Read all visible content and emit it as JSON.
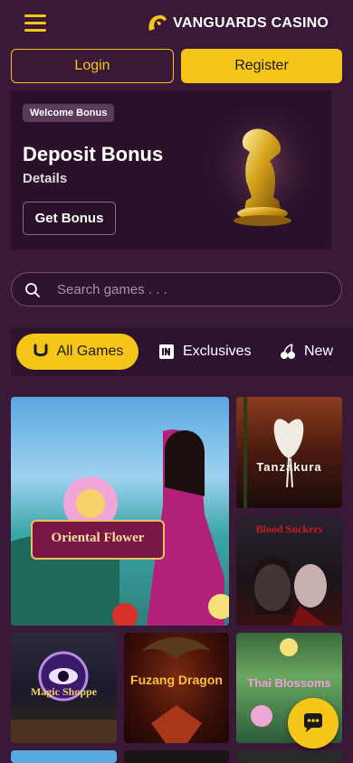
{
  "header": {
    "logo_brand": "VANGUARDS",
    "logo_suffix": "CASINO"
  },
  "auth": {
    "login_label": "Login",
    "register_label": "Register"
  },
  "banner": {
    "badge": "Welcome Bonus",
    "title": "Deposit Bonus",
    "subtitle": "Details",
    "button_label": "Get Bonus"
  },
  "search": {
    "placeholder": "Search games . . ."
  },
  "tabs": [
    {
      "label": "All Games",
      "icon": "horseshoe-icon",
      "active": true
    },
    {
      "label": "Exclusives",
      "icon": "exclusive-icon",
      "active": false
    },
    {
      "label": "New",
      "icon": "cherries-icon",
      "active": false
    }
  ],
  "games": [
    {
      "title": "Oriental Flower"
    },
    {
      "title": "Tanzakura"
    },
    {
      "title": "Blood Suckers"
    },
    {
      "title": "Magic Shoppe"
    },
    {
      "title": "Fuzang Dragon"
    },
    {
      "title": "Thai Blossoms"
    }
  ],
  "colors": {
    "accent": "#f5c518",
    "background": "#3a1838",
    "panel": "#2d1330"
  }
}
